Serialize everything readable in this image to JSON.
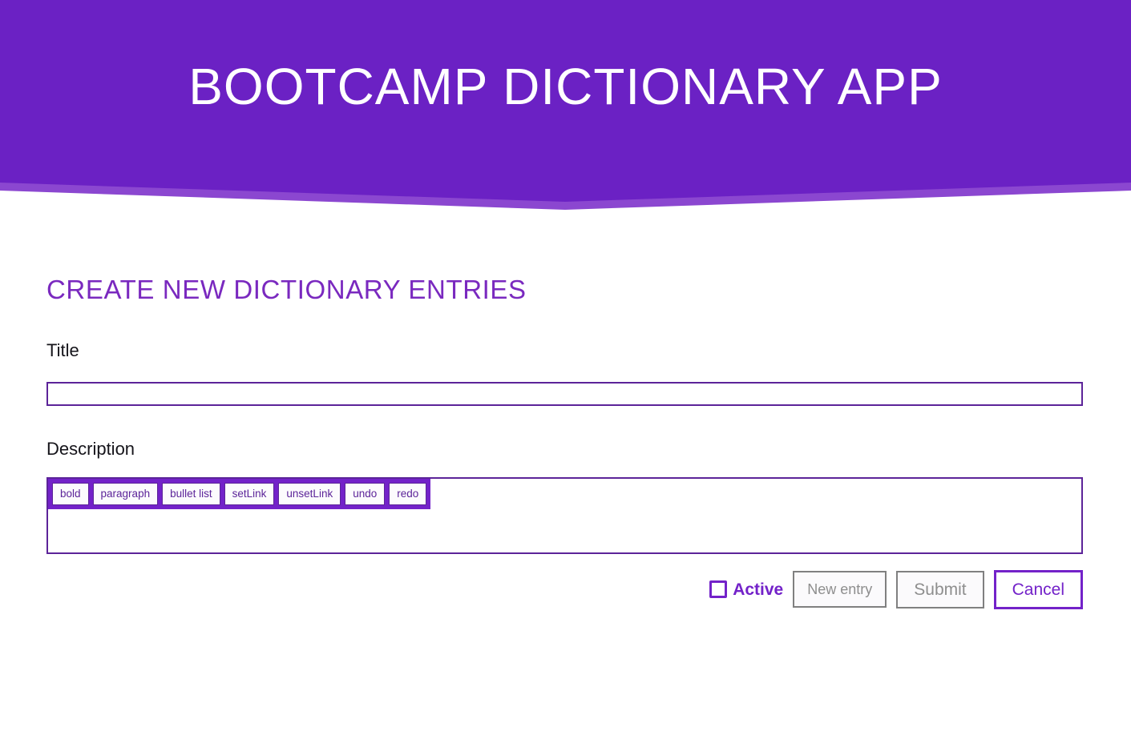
{
  "header": {
    "title": "BOOTCAMP DICTIONARY APP",
    "bg_color": "#6B21C4",
    "accent_color": "#8B47D0"
  },
  "form": {
    "heading": "CREATE NEW DICTIONARY ENTRIES",
    "heading_color": "#7A29BF",
    "title_field": {
      "label": "Title",
      "value": "",
      "placeholder": ""
    },
    "description_field": {
      "label": "Description",
      "value": "",
      "placeholder": ""
    },
    "toolbar": {
      "buttons": [
        {
          "label": "bold",
          "name": "bold-button"
        },
        {
          "label": "paragraph",
          "name": "paragraph-button"
        },
        {
          "label": "bullet list",
          "name": "bullet-list-button"
        },
        {
          "label": "setLink",
          "name": "set-link-button"
        },
        {
          "label": "unsetLink",
          "name": "unset-link-button"
        },
        {
          "label": "undo",
          "name": "undo-button"
        },
        {
          "label": "redo",
          "name": "redo-button"
        }
      ],
      "band_color": "#7322C9",
      "button_text_color": "#5C2499"
    },
    "actions": {
      "active_label": "Active",
      "active_checked": false,
      "new_entry_label": "New entry",
      "new_entry_disabled": true,
      "submit_label": "Submit",
      "submit_disabled": true,
      "cancel_label": "Cancel",
      "cancel_color": "#7322C9"
    }
  }
}
